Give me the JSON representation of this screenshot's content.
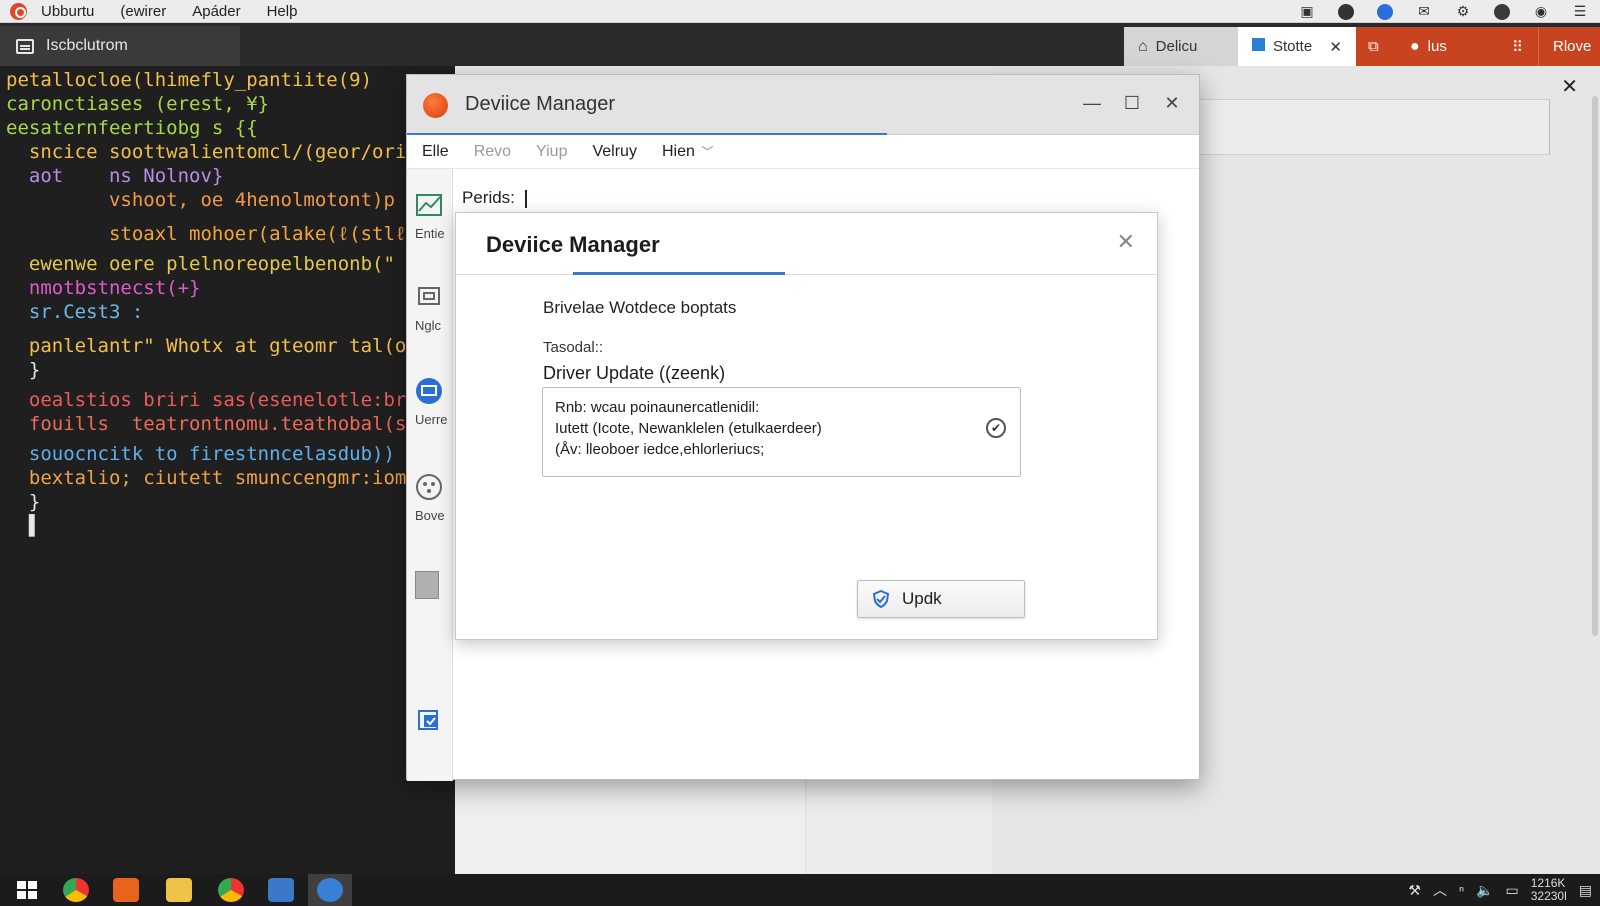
{
  "menubar": {
    "items": [
      "Ubburtu",
      "(ewirer",
      "Apáder",
      "Helþ"
    ]
  },
  "terminal": {
    "tab_label": "Iscbclutrom",
    "lines": [
      {
        "text": "petallocloe(lhimefly_pantiite(9)",
        "color": "#f2c04a"
      },
      {
        "text": "caronctiases (erest, ¥}",
        "color": "#a8d84a"
      },
      {
        "text": "eesaternfeertiobg s {{",
        "color": "#a8d84a"
      },
      {
        "text": "  sncice soottwalientomcl/(geor/ori",
        "color": "#f2c04a"
      },
      {
        "text": "  aot    ns Nolnov}",
        "color": "#b58ee6"
      },
      {
        "text": "         vshoot, oe 4henolmotont)p",
        "color": "#f29a4a"
      },
      {
        "text": "         stoaxl mohoer(alake(ℓ(stlℓe",
        "color": "#f2a63a"
      },
      {
        "text": "  ewenwe oere plelnoreopelbenonb(\"",
        "color": "#e6c84a"
      },
      {
        "text": "  nmotbstnecst(+}",
        "color": "#e05ad0"
      },
      {
        "text": "  sr.Cest3 :",
        "color": "#6fb7e8"
      },
      {
        "text": "  panlelantr\" Whotx at gteomr tal(oem",
        "color": "#f2c04a"
      },
      {
        "text": "  }",
        "color": "#e6e6e6"
      },
      {
        "text": "  oealstios briri sas(esenelotle:bro",
        "color": "#ee5a5a"
      },
      {
        "text": "  fouills  teatrontnomu.teathobal(s",
        "color": "#ee6a5a"
      },
      {
        "text": "  souocncitk to firestnncelasdub)) s",
        "color": "#5fb0ec"
      },
      {
        "text": "  bextalio; ciutett smunccengmr:iom",
        "color": "#f0a24a"
      },
      {
        "text": "  }",
        "color": "#e6e6e6"
      },
      {
        "text": "  ▌",
        "color": "#e6e6e6"
      }
    ]
  },
  "top_tabs": {
    "home_label": "Dеlісu",
    "active_label": "Stotte",
    "red1_label": "lus",
    "red2_label": "Rlove"
  },
  "main_window": {
    "title": "Deviice Manager",
    "menu": [
      {
        "label": "Elle",
        "dim": false
      },
      {
        "label": "Revo",
        "dim": true
      },
      {
        "label": "Yiup",
        "dim": true
      },
      {
        "label": "Velruy",
        "dim": false
      },
      {
        "label": "Hien",
        "dim": false
      }
    ],
    "sidebar": [
      "Entie",
      "Nglc",
      "Uerre",
      "Bove"
    ],
    "periods_label": "Perids:"
  },
  "dialog": {
    "title": "Deviice Manager",
    "heading": "Brivelae Wotdece boptats",
    "small_label": "Tasodal::",
    "driver_title": "Driver Update ((zeenk)",
    "info_lines": [
      "Rnb: wcau poinaunercatlenidil:",
      "Iutett (Icote, Newanklelen (etulkaerdeer)",
      "(Åv: lleoboer iedce,ehlorleriucs;"
    ],
    "button_label": "Updk"
  },
  "taskbar": {
    "clock_time": "1216K",
    "clock_date": "32230l"
  },
  "colors": {
    "accent_blue": "#3b78c8",
    "tab_red": "#c8431f",
    "terminal_bg": "#1f1f1f"
  }
}
